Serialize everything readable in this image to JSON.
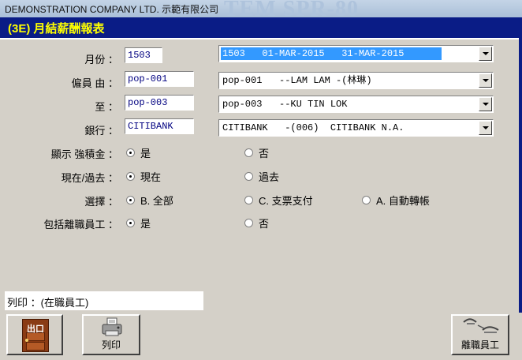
{
  "window": {
    "company": "DEMONSTRATION COMPANY LTD. 示範有限公司",
    "watermark": "TEM SPR-80"
  },
  "header": {
    "title": "(3E) 月結薪酬報表"
  },
  "form": {
    "month": {
      "label": "月份 ：",
      "code": "1503",
      "combo": "1503   01-MAR-2015   31-MAR-2015"
    },
    "emp_from": {
      "label": "僱員 由 ：",
      "code": "pop-001",
      "combo": "pop-001   --LAM LAM -(林琳)"
    },
    "emp_to": {
      "label": "至 ：",
      "code": "pop-003",
      "combo": "pop-003   --KU TIN LOK"
    },
    "bank": {
      "label": "銀行 ：",
      "code": "CITIBANK",
      "combo": "CITIBANK   -(006)  CITIBANK N.A."
    }
  },
  "options": {
    "show_mpf": {
      "label": "顯示 強積金 ：",
      "choices": [
        "是",
        "否"
      ],
      "selected": 0
    },
    "current_past": {
      "label": "現在/過去 ：",
      "choices": [
        "現在",
        "過去"
      ],
      "selected": 0
    },
    "select": {
      "label": "選擇 ：",
      "choices": [
        "B. 全部",
        "C. 支票支付",
        "A. 自動轉帳"
      ],
      "selected": 0
    },
    "include_left": {
      "label": "包括離職員工 ：",
      "choices": [
        "是",
        "否"
      ],
      "selected": 0
    }
  },
  "status": {
    "print": "列印 ：(在職員工)"
  },
  "buttons": {
    "exit": "出口",
    "print": "列印",
    "resigned": "離職員工"
  },
  "colors": {
    "header_bg": "#0a1c86",
    "header_text": "#ffff00",
    "form_bg": "#d4d0c8",
    "selection": "#3399ff"
  },
  "icons": {
    "exit": "door-icon",
    "print": "printer-icon",
    "resigned": "wave-icon"
  }
}
